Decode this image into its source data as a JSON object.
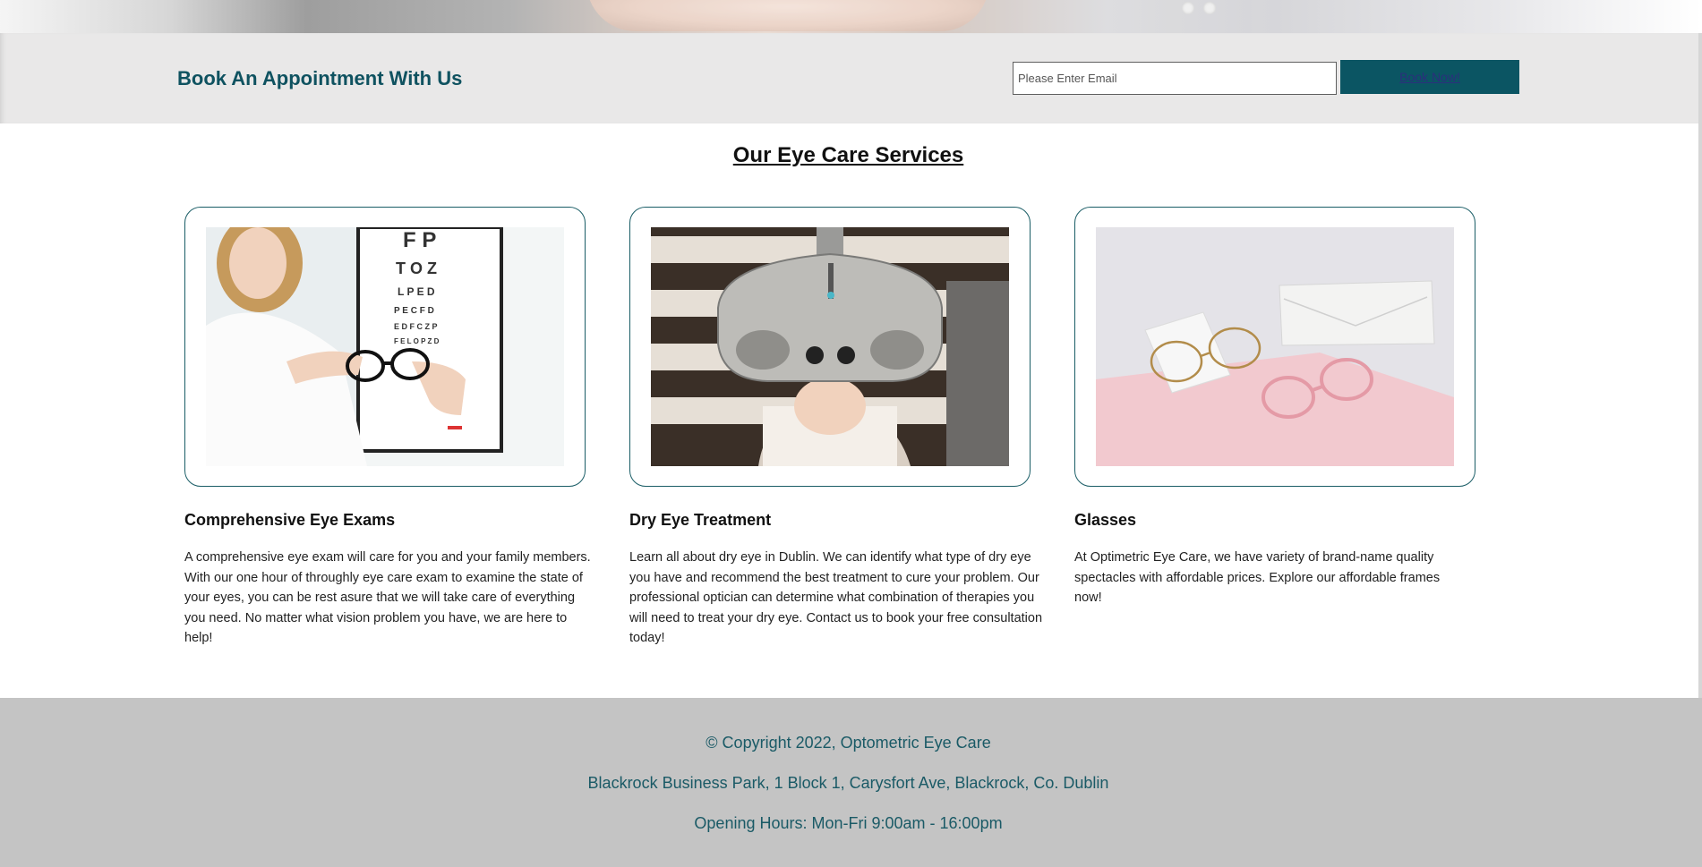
{
  "appointment": {
    "title": "Book An Appointment With Us",
    "email_placeholder": "Please Enter Email",
    "email_value": "",
    "button_label": "Book Now!"
  },
  "services": {
    "title": "Our Eye Care Services",
    "cards": [
      {
        "title": "Comprehensive Eye Exams",
        "text": "A comprehensive eye exam will care for you and your family members. With our one hour of throughly eye care exam to examine the state of your eyes, you can be rest asure that we will take care of everything you need. No matter what vision problem you have, we are here to help!"
      },
      {
        "title": "Dry Eye Treatment",
        "text": "Learn all about dry eye in Dublin. We can identify what type of dry eye you have and recommend the best treatment to cure your problem. Our professional optician can determine what combination of therapies you will need to treat your dry eye. Contact us to book your free consultation today!"
      },
      {
        "title": "Glasses",
        "text": "At Optimetric Eye Care, we have variety of brand-name quality spectacles with affordable prices. Explore our affordable frames now!"
      }
    ]
  },
  "footer": {
    "copyright": "© Copyright 2022, Optometric Eye Care",
    "address": "Blackrock Business Park, 1 Block 1, Carysfort Ave, Blackrock, Co. Dublin",
    "hours": "Opening Hours: Mon-Fri 9:00am - 16:00pm"
  },
  "colors": {
    "brand": "#0b5563",
    "band_bg": "#e9e8e8",
    "footer_bg": "#c4c4c4"
  }
}
